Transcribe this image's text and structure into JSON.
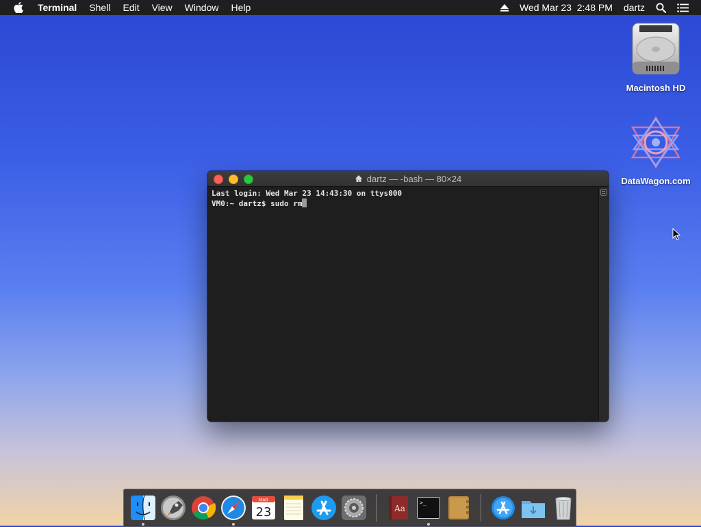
{
  "menubar": {
    "app_name": "Terminal",
    "items": [
      "Shell",
      "Edit",
      "View",
      "Window",
      "Help"
    ],
    "clock": "Wed Mar 23  2:48 PM",
    "user": "dartz"
  },
  "desktop": {
    "icons": [
      {
        "label": "Macintosh HD",
        "icon": "hard-drive-icon"
      },
      {
        "label": "DataWagon.com",
        "icon": "datawagon-icon"
      }
    ]
  },
  "terminal": {
    "title": "dartz — -bash — 80×24",
    "lines": [
      "Last login: Wed Mar 23 14:43:30 on ttys000",
      "VM0:~ dartz$ sudo rm"
    ]
  },
  "dock": {
    "apps": [
      {
        "name": "Finder",
        "icon": "finder-icon",
        "running": true
      },
      {
        "name": "Launchpad",
        "icon": "launchpad-icon",
        "running": false
      },
      {
        "name": "Google Chrome",
        "icon": "chrome-icon",
        "running": false
      },
      {
        "name": "Safari",
        "icon": "safari-icon",
        "running": true
      },
      {
        "name": "Calendar",
        "icon": "calendar-icon",
        "running": false
      },
      {
        "name": "Notes",
        "icon": "notes-icon",
        "running": false
      },
      {
        "name": "App Store",
        "icon": "app-store-icon",
        "running": false
      },
      {
        "name": "System Preferences",
        "icon": "system-preferences-icon",
        "running": false
      },
      {
        "name": "Dictionary",
        "icon": "dictionary-icon",
        "running": false
      },
      {
        "name": "Terminal",
        "icon": "terminal-icon",
        "running": true
      },
      {
        "name": "Notefile",
        "icon": "notebook-icon",
        "running": false
      },
      {
        "name": "Applications",
        "icon": "applications-folder-icon",
        "running": false
      },
      {
        "name": "Downloads",
        "icon": "downloads-folder-icon",
        "running": false
      },
      {
        "name": "Trash",
        "icon": "trash-icon",
        "running": false
      }
    ],
    "calendar": {
      "month": "MAR",
      "day": "23"
    }
  },
  "colors": {
    "menubar_bg": "#1f1f21",
    "terminal_bg": "#1e1e1e",
    "close": "#fe5f57",
    "minimize": "#febc2e",
    "maximize": "#28c840"
  }
}
